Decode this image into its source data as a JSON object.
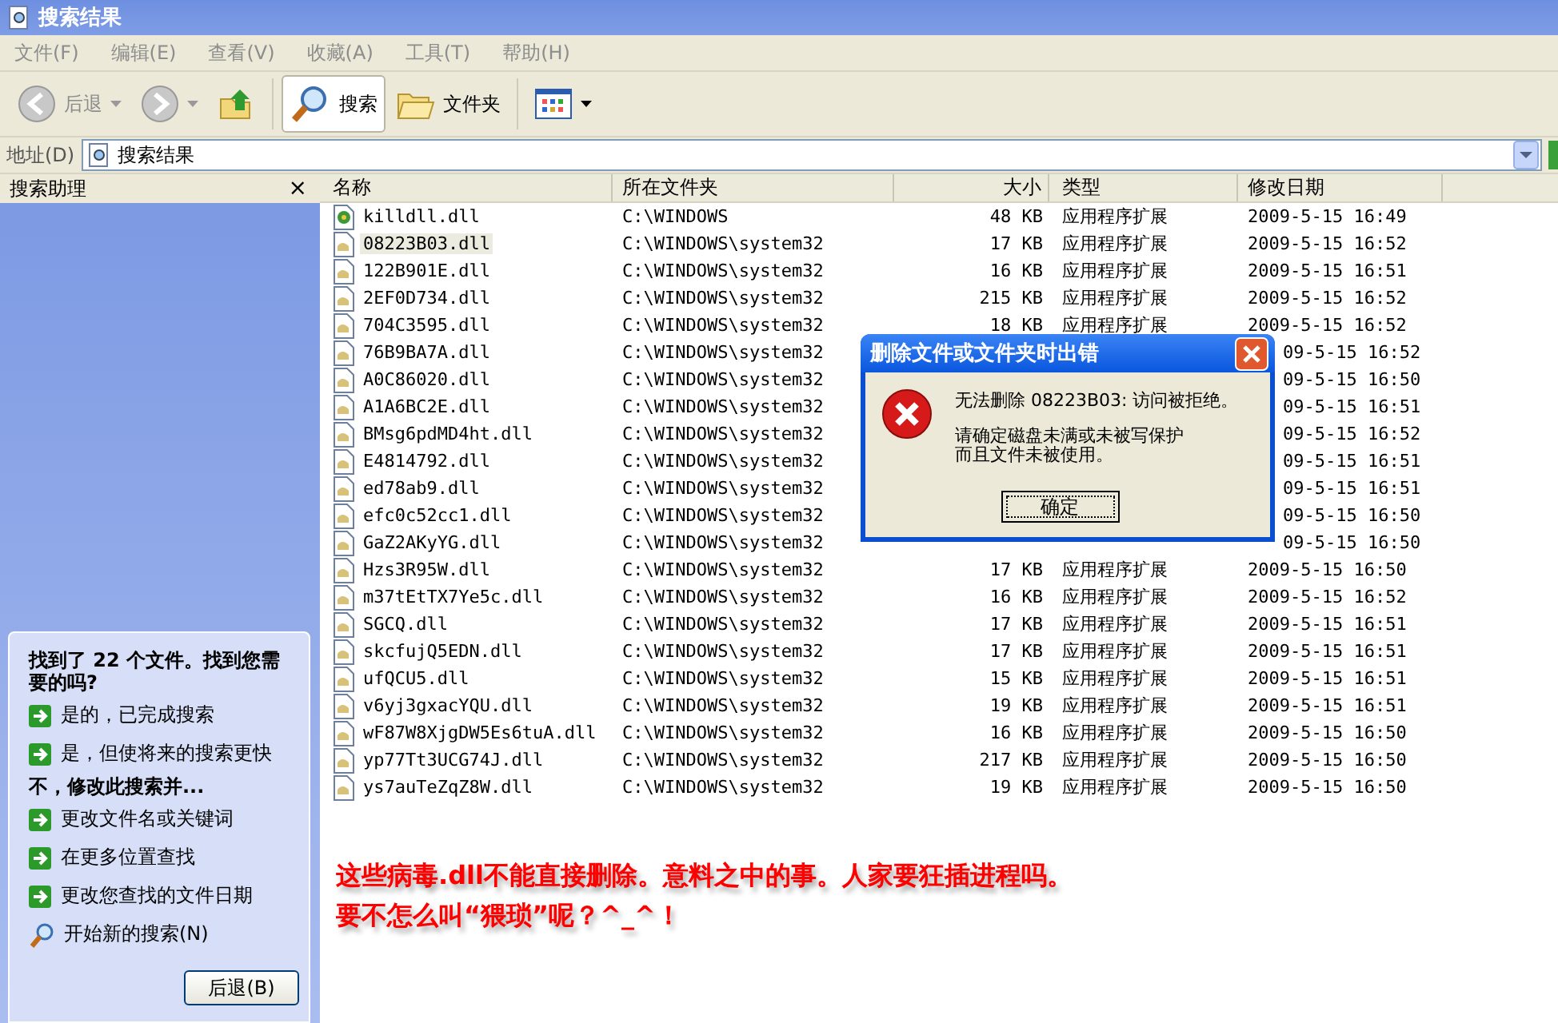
{
  "window": {
    "title": "搜索结果"
  },
  "menu": [
    "文件(F)",
    "编辑(E)",
    "查看(V)",
    "收藏(A)",
    "工具(T)",
    "帮助(H)"
  ],
  "toolbar": [
    {
      "kind": "back",
      "label": "后退",
      "disabled": true
    },
    {
      "kind": "forward",
      "disabled": true
    },
    {
      "kind": "up"
    },
    {
      "kind": "search",
      "label": "搜索",
      "selected": true
    },
    {
      "kind": "folders",
      "label": "文件夹",
      "selected": false
    },
    {
      "kind": "views"
    }
  ],
  "address": {
    "label": "地址(D)",
    "value": "搜索结果"
  },
  "assistant": {
    "title": "搜索助理",
    "close": "×",
    "heading": "找到了 22 个文件。找到您需要的吗?",
    "items": [
      {
        "kind": "link",
        "text": "是的，已完成搜索"
      },
      {
        "kind": "link",
        "text": "是，但使将来的搜索更快"
      },
      {
        "kind": "subheading",
        "text": "不，修改此搜索并..."
      },
      {
        "kind": "link",
        "text": "更改文件名或关键词"
      },
      {
        "kind": "link",
        "text": "在更多位置查找"
      },
      {
        "kind": "link",
        "text": "更改您查找的文件日期"
      },
      {
        "kind": "search",
        "text": "开始新的搜索(N)"
      }
    ],
    "button": "后退(B)"
  },
  "table": {
    "columns": [
      "名称",
      "所在文件夹",
      "大小",
      "类型",
      "修改日期"
    ],
    "rows": [
      {
        "name": "killdll.dll",
        "folder": "C:\\WINDOWS",
        "size": "48 KB",
        "type": "应用程序扩展",
        "date": "2009-5-15 16:49",
        "selected": false,
        "special": true
      },
      {
        "name": "08223B03.dll",
        "folder": "C:\\WINDOWS\\system32",
        "size": "17 KB",
        "type": "应用程序扩展",
        "date": "2009-5-15 16:52",
        "selected": true
      },
      {
        "name": "122B901E.dll",
        "folder": "C:\\WINDOWS\\system32",
        "size": "16 KB",
        "type": "应用程序扩展",
        "date": "2009-5-15 16:51",
        "selected": false
      },
      {
        "name": "2EF0D734.dll",
        "folder": "C:\\WINDOWS\\system32",
        "size": "215 KB",
        "type": "应用程序扩展",
        "date": "2009-5-15 16:52",
        "selected": false
      },
      {
        "name": "704C3595.dll",
        "folder": "C:\\WINDOWS\\system32",
        "size": "18 KB",
        "type": "应用程序扩展",
        "date": "2009-5-15 16:52",
        "selected": false
      },
      {
        "name": "76B9BA7A.dll",
        "folder": "C:\\WINDOWS\\system32",
        "date": "09-5-15 16:52",
        "selected": false,
        "covered": true
      },
      {
        "name": "A0C86020.dll",
        "folder": "C:\\WINDOWS\\system32",
        "date": "09-5-15 16:50",
        "selected": false,
        "covered": true
      },
      {
        "name": "A1A6BC2E.dll",
        "folder": "C:\\WINDOWS\\system32",
        "date": "09-5-15 16:51",
        "selected": false,
        "covered": true
      },
      {
        "name": "BMsg6pdMD4ht.dll",
        "folder": "C:\\WINDOWS\\system32",
        "date": "09-5-15 16:52",
        "selected": false,
        "covered": true
      },
      {
        "name": "E4814792.dll",
        "folder": "C:\\WINDOWS\\system32",
        "date": "09-5-15 16:51",
        "selected": false,
        "covered": true
      },
      {
        "name": "ed78ab9.dll",
        "folder": "C:\\WINDOWS\\system32",
        "date": "09-5-15 16:51",
        "selected": false,
        "covered": true
      },
      {
        "name": "efc0c52cc1.dll",
        "folder": "C:\\WINDOWS\\system32",
        "date": "09-5-15 16:50",
        "selected": false,
        "covered": true
      },
      {
        "name": "GaZ2AKyYG.dll",
        "folder": "C:\\WINDOWS\\system32",
        "date": "09-5-15 16:50",
        "selected": false,
        "covered": true
      },
      {
        "name": "Hzs3R95W.dll",
        "folder": "C:\\WINDOWS\\system32",
        "size": "17 KB",
        "type": "应用程序扩展",
        "date": "2009-5-15 16:50",
        "selected": false
      },
      {
        "name": "m37tEtTX7Ye5c.dll",
        "folder": "C:\\WINDOWS\\system32",
        "size": "16 KB",
        "type": "应用程序扩展",
        "date": "2009-5-15 16:52",
        "selected": false
      },
      {
        "name": "SGCQ.dll",
        "folder": "C:\\WINDOWS\\system32",
        "size": "17 KB",
        "type": "应用程序扩展",
        "date": "2009-5-15 16:51",
        "selected": false
      },
      {
        "name": "skcfujQ5EDN.dll",
        "folder": "C:\\WINDOWS\\system32",
        "size": "17 KB",
        "type": "应用程序扩展",
        "date": "2009-5-15 16:51",
        "selected": false
      },
      {
        "name": "ufQCU5.dll",
        "folder": "C:\\WINDOWS\\system32",
        "size": "15 KB",
        "type": "应用程序扩展",
        "date": "2009-5-15 16:51",
        "selected": false
      },
      {
        "name": "v6yj3gxacYQU.dll",
        "folder": "C:\\WINDOWS\\system32",
        "size": "19 KB",
        "type": "应用程序扩展",
        "date": "2009-5-15 16:51",
        "selected": false
      },
      {
        "name": "wF87W8XjgDW5Es6tuA.dll",
        "folder": "C:\\WINDOWS\\system32",
        "size": "16 KB",
        "type": "应用程序扩展",
        "date": "2009-5-15 16:50",
        "selected": false
      },
      {
        "name": "yp77Tt3UCG74J.dll",
        "folder": "C:\\WINDOWS\\system32",
        "size": "217 KB",
        "type": "应用程序扩展",
        "date": "2009-5-15 16:50",
        "selected": false
      },
      {
        "name": "ys7auTeZqZ8W.dll",
        "folder": "C:\\WINDOWS\\system32",
        "size": "19 KB",
        "type": "应用程序扩展",
        "date": "2009-5-15 16:50",
        "selected": false
      }
    ]
  },
  "annotation": [
    "这些病毒.dll不能直接删除。意料之中的事。人家要狂插进程吗。",
    "要不怎么叫“猥琐”呢？^_^！"
  ],
  "dialog": {
    "title": "删除文件或文件夹时出错",
    "message": "无法删除 08223B03: 访问被拒绝。",
    "detail": [
      "请确定磁盘未满或未被写保护",
      "而且文件未被使用。"
    ],
    "button": "确定"
  }
}
